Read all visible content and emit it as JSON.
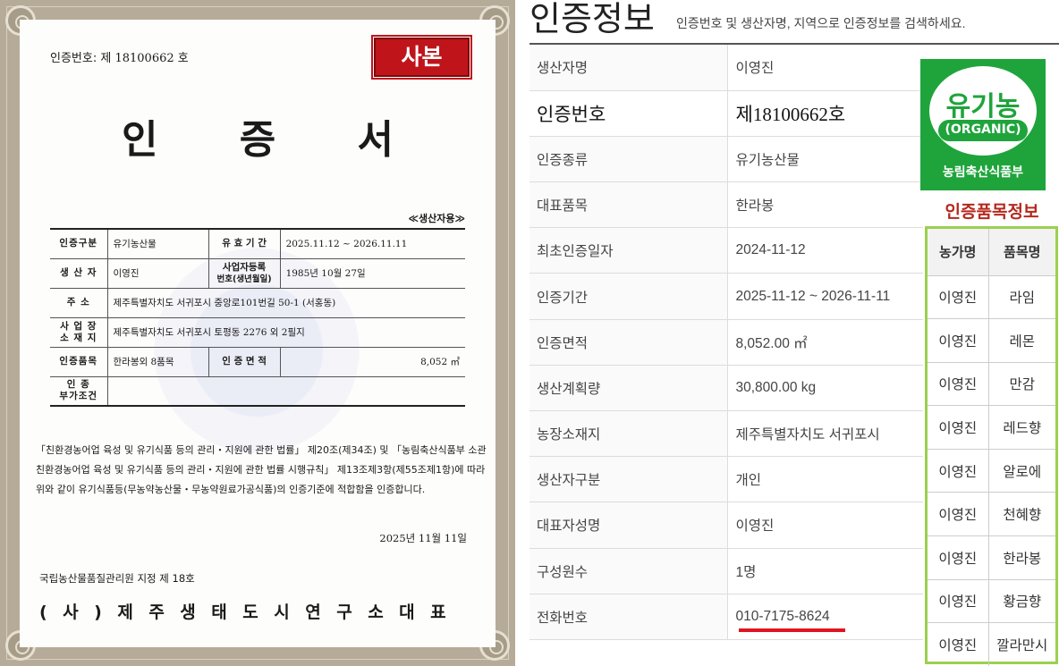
{
  "certificate": {
    "number_label": "인증번호:",
    "number_value": "제 18100662 호",
    "copy_stamp": "사본",
    "title": "인 증 서",
    "producer_use": "≪생산자용≫",
    "rows": {
      "type_label": "인증구분",
      "type_value": "유기농산물",
      "valid_label": "유 효 기 간",
      "valid_value": "2025.11.12 ~ 2026.11.11",
      "producer_label": "생 산 자",
      "producer_value": "이영진",
      "reg_label_1": "사업자등록",
      "reg_label_2": "번호(생년월일)",
      "reg_value": "1985년 10월 27일",
      "addr_label": "주 소",
      "addr_value": "제주특별자치도 서귀포시 중앙로101번길 50-1 (서홍동)",
      "site_label_1": "사 업 장",
      "site_label_2": "소 재 지",
      "site_value": "제주특별자치도 서귀포시 토평동 2276 외 2필지",
      "items_label": "인증품목",
      "items_value": "한라봉외 8품목",
      "area_label": "인 증 면 적",
      "area_value": "8,052 ㎡",
      "cond_label_1": "인 종",
      "cond_label_2": "부가조건",
      "cond_value": ""
    },
    "law_text": "「친환경농어업 육성 및 유기식품 등의 관리・지원에 관한 법률」 제20조(제34조) 및 「농림축산식품부 소관 친환경농어업 육성 및 유기식품 등의 관리・지원에 관한 법률 시행규칙」 제13조제3항(제55조제1항)에 따라 위와 같이 유기식품등(무농약농산물・무농약원료가공식품)의 인증기준에 적합함을 인증합니다.",
    "issue_date": "2025년 11월 11일",
    "designation": "국립농산물품질관리원 지정 제 18호",
    "signatory": "(사)제주생태도시연구소대표"
  },
  "info": {
    "title": "인증정보",
    "subtitle": "인증번호 및 생산자명, 지역으로 인증정보를 검색하세요.",
    "rows": [
      {
        "key": "생산자명",
        "value": "이영진"
      },
      {
        "key": "인증번호",
        "value": "제18100662호"
      },
      {
        "key": "인증종류",
        "value": "유기농산물"
      },
      {
        "key": "대표품목",
        "value": "한라봉"
      },
      {
        "key": "최초인증일자",
        "value": "2024-11-12"
      },
      {
        "key": "인증기간",
        "value": "2025-11-12 ~ 2026-11-11"
      },
      {
        "key": "인증면적",
        "value": "8,052.00 ㎡"
      },
      {
        "key": "생산계획량",
        "value": "30,800.00 kg"
      },
      {
        "key": "농장소재지",
        "value": "제주특별자치도 서귀포시"
      },
      {
        "key": "생산자구분",
        "value": "개인"
      },
      {
        "key": "대표자성명",
        "value": "이영진"
      },
      {
        "key": "구성원수",
        "value": "1명"
      },
      {
        "key": "전화번호",
        "value": "010-7175-8624"
      }
    ],
    "highlight_color": "#e1141e"
  },
  "organic_logo": {
    "word": "유기농",
    "english": "(ORGANIC)",
    "ministry": "농림축산식품부",
    "color": "#1fa43c"
  },
  "items": {
    "title": "인증품목정보",
    "headers": [
      "농가명",
      "품목명"
    ],
    "rows": [
      [
        "이영진",
        "라임"
      ],
      [
        "이영진",
        "레몬"
      ],
      [
        "이영진",
        "만감"
      ],
      [
        "이영진",
        "레드향"
      ],
      [
        "이영진",
        "알로에"
      ],
      [
        "이영진",
        "천혜향"
      ],
      [
        "이영진",
        "한라봉"
      ],
      [
        "이영진",
        "황금향"
      ],
      [
        "이영진",
        "깔라만시"
      ]
    ],
    "border_color": "#9bd04f"
  }
}
